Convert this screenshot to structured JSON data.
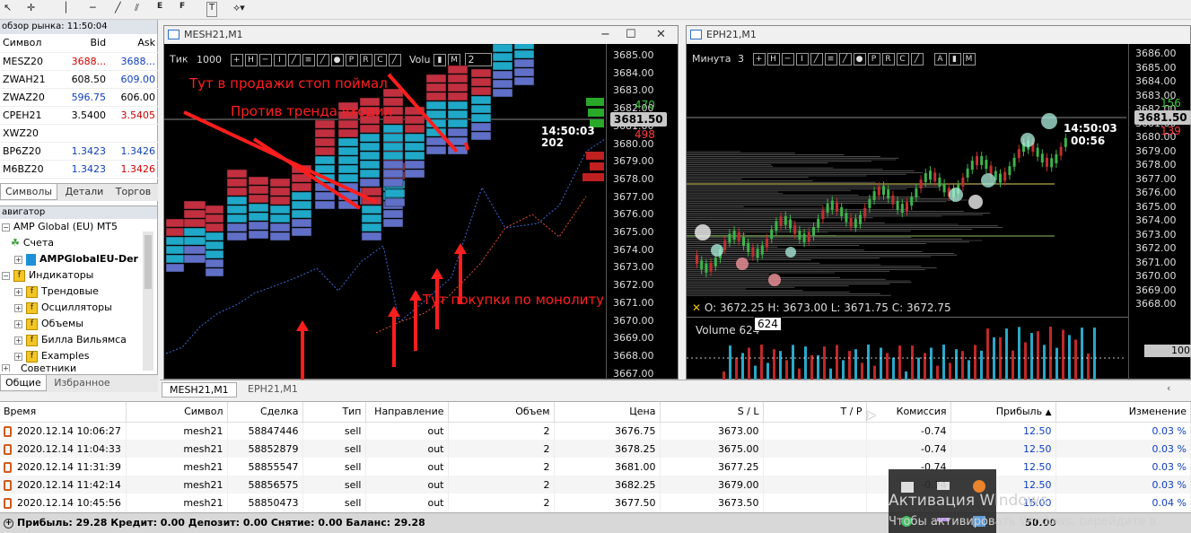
{
  "toolbar": {
    "labels": [
      "F",
      "T"
    ]
  },
  "market_watch": {
    "title": "обзор рынка: 11:50:04",
    "headers": [
      "Символ",
      "Bid",
      "Ask"
    ],
    "rows": [
      {
        "symbol": "MESZ20",
        "bid": "3688...",
        "ask": "3688..."
      },
      {
        "symbol": "ZWAH21",
        "bid": "608.50",
        "ask": "609.00"
      },
      {
        "symbol": "ZWAZ20",
        "bid": "596.75",
        "ask": "606.00"
      },
      {
        "symbol": "CPEH21",
        "bid": "3.5400",
        "ask": "3.5405"
      },
      {
        "symbol": "XWZ20",
        "bid": "",
        "ask": ""
      },
      {
        "symbol": "BP6Z20",
        "bid": "1.3423",
        "ask": "1.3426"
      },
      {
        "symbol": "M6BZ20",
        "bid": "1.3423",
        "ask": "1.3426"
      }
    ],
    "tabs": [
      "Символы",
      "Детали",
      "Торгов"
    ]
  },
  "navigator": {
    "title": "авигатор",
    "items": [
      {
        "label": "AMP Global (EU) MT5",
        "indent": 0
      },
      {
        "label": "Счета",
        "indent": 1
      },
      {
        "label": "AMPGlobalEU-Der",
        "indent": 2,
        "bold": true
      },
      {
        "label": "Индикаторы",
        "indent": 1
      },
      {
        "label": "Трендовые",
        "indent": 2
      },
      {
        "label": "Осцилляторы",
        "indent": 2
      },
      {
        "label": "Объемы",
        "indent": 2
      },
      {
        "label": "Билла Вильямса",
        "indent": 2
      },
      {
        "label": "Examples",
        "indent": 2
      },
      {
        "label": "Советники",
        "indent": 1
      }
    ],
    "tabs": [
      "Общие",
      "Избранное"
    ]
  },
  "chart1": {
    "title": "MESH21,M1",
    "tick_label": "Тик",
    "tick_value": "1000",
    "tool_letters": [
      "H",
      "I",
      "P",
      "R",
      "C"
    ],
    "value_label": "Volu",
    "spin_value": "2",
    "price_labels": [
      "3685.00",
      "3684.00",
      "3683.00",
      "3682.00",
      "3681.00",
      "3680.00",
      "3679.00",
      "3678.00",
      "3677.00",
      "3676.00",
      "3675.00",
      "3674.00",
      "3673.00",
      "3672.00",
      "3671.00",
      "3670.00",
      "3669.00",
      "3668.00",
      "3667.00"
    ],
    "current_price": "3681.50",
    "time": "14:50:03",
    "ticks": "202",
    "dom_top": "470",
    "dom_bottom": "498",
    "annotations": {
      "a1": "Тут в продажи стоп поймал",
      "a2": "Против тренда входил",
      "a3": "Тут покупки по монолиту"
    }
  },
  "chart2": {
    "title": "EPH21,M1",
    "period_label": "Минута",
    "period_value": "3",
    "tool_letters": [
      "H",
      "I",
      "P",
      "R",
      "C",
      "A"
    ],
    "price_labels": [
      "3686.00",
      "3685.00",
      "3684.00",
      "3683.00",
      "3682.00",
      "3681.00",
      "3680.00",
      "3679.00",
      "3678.00",
      "3677.00",
      "3676.00",
      "3675.00",
      "3674.00",
      "3673.00",
      "3672.00",
      "3671.00",
      "3670.00",
      "3669.00",
      "3668.00"
    ],
    "current_price": "3681.50",
    "time": "14:50:03",
    "countdown": "00:56",
    "dom_top": "156",
    "dom_bottom": "139",
    "ohlc": "O: 3672.25   H: 3673.00   L: 3671.75   C: 3672.75",
    "volume_label": "Volume 624",
    "volume_tag": "624",
    "volume_scale": "100"
  },
  "chart_tabs": [
    "MESH21,M1",
    "EPH21,M1"
  ],
  "trade": {
    "headers": [
      "Время",
      "Символ",
      "Сделка",
      "Тип",
      "Направление",
      "Объем",
      "Цена",
      "S / L",
      "T / P",
      "Комиссия",
      "Прибыль",
      "Изменение"
    ],
    "sort_arrow": "▲",
    "rows": [
      [
        "2020.12.14 10:06:27",
        "mesh21",
        "58847446",
        "sell",
        "out",
        "2",
        "3676.75",
        "3673.00",
        "",
        "-0.74",
        "12.50",
        "0.03 %"
      ],
      [
        "2020.12.14 11:04:33",
        "mesh21",
        "58852879",
        "sell",
        "out",
        "2",
        "3678.25",
        "3675.00",
        "",
        "-0.74",
        "12.50",
        "0.03 %"
      ],
      [
        "2020.12.14 11:31:39",
        "mesh21",
        "58855547",
        "sell",
        "out",
        "2",
        "3681.00",
        "3677.25",
        "",
        "-0.74",
        "12.50",
        "0.03 %"
      ],
      [
        "2020.12.14 11:42:14",
        "mesh21",
        "58856575",
        "sell",
        "out",
        "2",
        "3682.25",
        "3679.00",
        "",
        "-0.74",
        "12.50",
        "0.03 %"
      ],
      [
        "2020.12.14 10:45:56",
        "mesh21",
        "58850473",
        "sell",
        "out",
        "2",
        "3677.50",
        "3673.50",
        "",
        "-0.74",
        "15.00",
        "0.04 %"
      ]
    ]
  },
  "status": {
    "text": "Прибыль: 29.28  Кредит: 0.00  Депозит: 0.00  Снятие: 0.00  Баланс: 29.28",
    "total": "50.00"
  },
  "windows_watermark": {
    "line1": "Активация Windows",
    "line2": "Чтобы активировать Windows, перейдите в"
  },
  "colors": {
    "annotation": "#ff1e1e",
    "profit": "#1040c0",
    "ask_red": "#d00000",
    "bid_blue": "#1040c0"
  }
}
